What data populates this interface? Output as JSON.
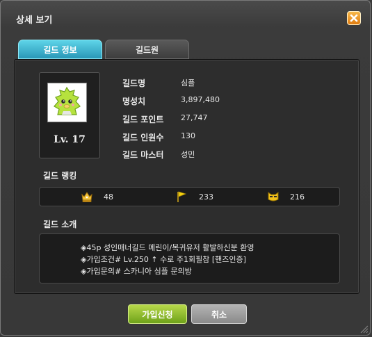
{
  "window": {
    "title": "상세 보기"
  },
  "tabs": [
    {
      "label": "길드 정보"
    },
    {
      "label": "길드원"
    }
  ],
  "guild": {
    "level": "Lv. 17",
    "fields": [
      {
        "key": "길드명",
        "value": "심플"
      },
      {
        "key": "명성치",
        "value": "3,897,480"
      },
      {
        "key": "길드 포인트",
        "value": "27,747"
      },
      {
        "key": "길드 인원수",
        "value": "130"
      },
      {
        "key": "길드 마스터",
        "value": "성민"
      }
    ]
  },
  "ranking": {
    "title": "길드 랭킹",
    "items": [
      {
        "icon": "crown-icon",
        "value": "48"
      },
      {
        "icon": "flag-icon",
        "value": "233"
      },
      {
        "icon": "cat-mask-icon",
        "value": "216"
      }
    ]
  },
  "intro": {
    "title": "길드 소개",
    "lines": [
      "◈45p 성인매너길드 메린이/복귀유저 활발하신분 환영",
      "◈가입조건# Lv.250 ↑ 수로 주1회필참 [핸즈인증]",
      "◈가입문의# 스카니아 심플 문의방"
    ]
  },
  "buttons": {
    "join": "가입신청",
    "cancel": "취소"
  },
  "colors": {
    "accent_tab": "#2a98b8",
    "join_button": "#8cb92a",
    "close_button": "#e88a1c"
  }
}
